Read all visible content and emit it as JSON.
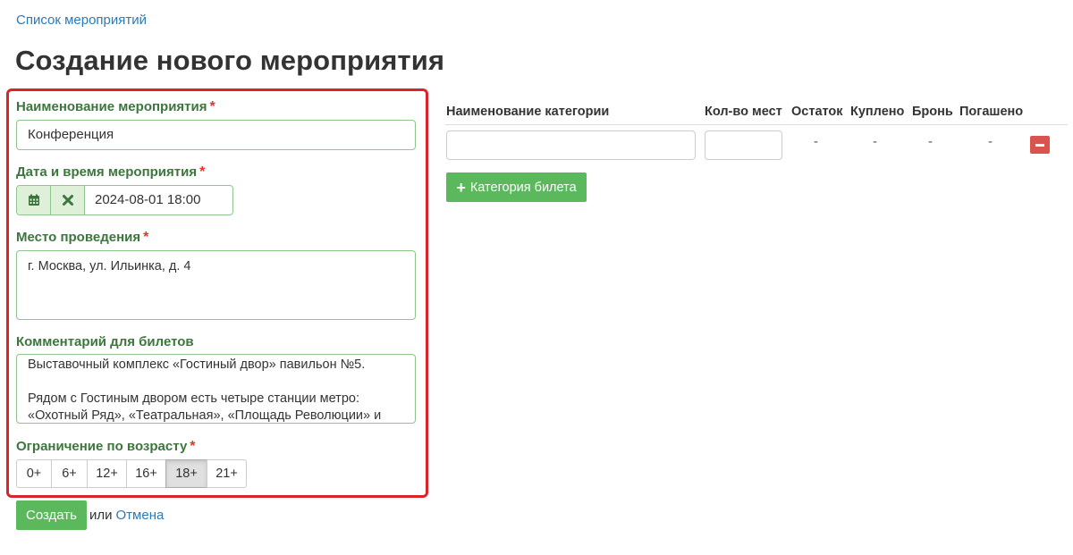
{
  "breadcrumb": {
    "link": "Список мероприятий"
  },
  "page_title": "Создание нового мероприятия",
  "form": {
    "name": {
      "label": "Наименование мероприятия",
      "required_mark": "*",
      "value": "Конференция"
    },
    "datetime": {
      "label": "Дата и время мероприятия",
      "required_mark": "*",
      "value": "2024-08-01 18:00",
      "calendar_icon": "calendar-icon",
      "clear_icon": "close-icon"
    },
    "place": {
      "label": "Место проведения",
      "required_mark": "*",
      "value": "г. Москва, ул. Ильинка, д. 4"
    },
    "comment": {
      "label": "Комментарий для билетов",
      "value": "Выставочный комплекс «Гостиный двор» павильон №5.\n\nРядом с Гостиным двором есть четыре станции метро: «Охотный Ряд», «Театральная», «Площадь Революции» и «Китай-город»."
    },
    "age": {
      "label": "Ограничение по возрасту",
      "required_mark": "*",
      "options": [
        "0+",
        "6+",
        "12+",
        "16+",
        "18+",
        "21+"
      ],
      "selected": "18+"
    },
    "submit_label": "Создать",
    "or_text": "или",
    "cancel_label": "Отмена"
  },
  "categories": {
    "headers": {
      "name": "Наименование категории",
      "qty": "Кол-во мест",
      "remaining": "Остаток",
      "bought": "Куплено",
      "reserved": "Бронь",
      "redeemed": "Погашено"
    },
    "row": {
      "name": "",
      "qty": "",
      "remaining": "-",
      "bought": "-",
      "reserved": "-",
      "redeemed": "-",
      "remove_icon": "minus-icon"
    },
    "add_button": {
      "label": "Категория билета",
      "icon": "plus-icon"
    }
  },
  "colors": {
    "accent_green": "#5cb85c",
    "label_green": "#3c763d",
    "danger_red": "#d9534f",
    "highlight_border": "#d9252a",
    "link_blue": "#2a7ab8"
  }
}
